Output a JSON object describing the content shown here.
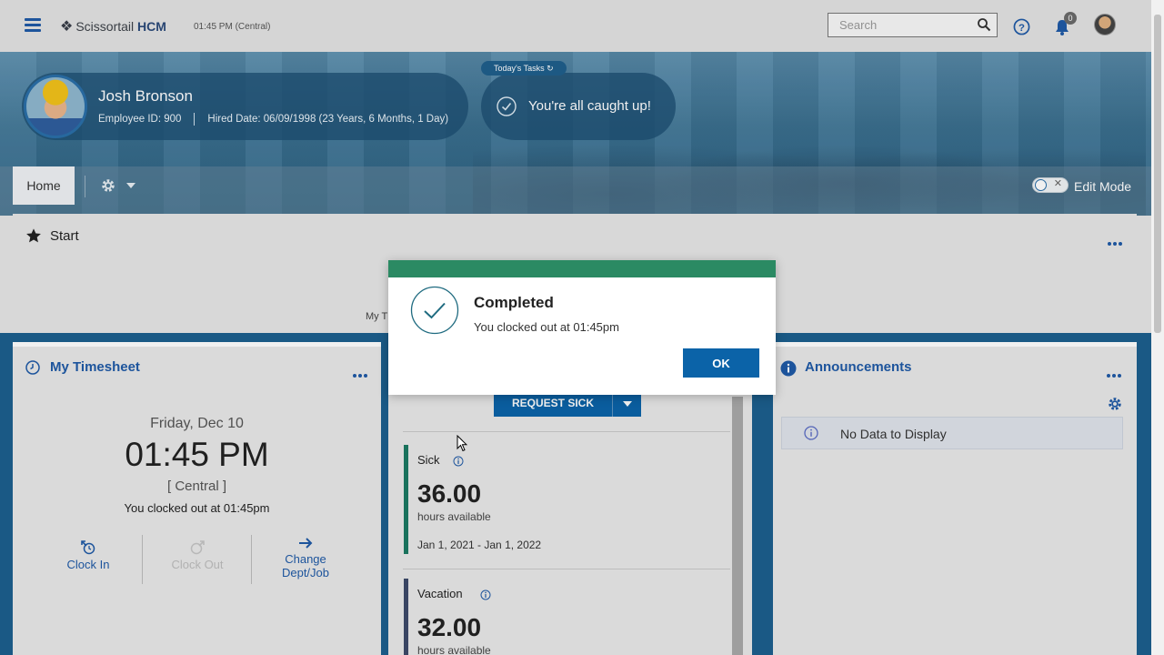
{
  "topbar": {
    "brand_prefix": "Scissortail",
    "brand_suffix": "HCM",
    "time": "01:45 PM (Central)",
    "search_placeholder": "Search",
    "notification_count": "0"
  },
  "profile": {
    "name": "Josh Bronson",
    "employee_id": "Employee ID: 900",
    "hired": "Hired Date: 06/09/1998 (23 Years, 6 Months, 1 Day)"
  },
  "tasks": {
    "label": "Today's Tasks",
    "status": "You're all caught up!"
  },
  "nav": {
    "home_tab": "Home",
    "edit_mode": "Edit Mode"
  },
  "start": {
    "title": "Start",
    "partial_label": "My T"
  },
  "timesheet": {
    "title": "My Timesheet",
    "date": "Friday, Dec 10",
    "time": "01:45 PM",
    "zone": "[ Central ]",
    "status": "You clocked out at 01:45pm",
    "clock_in": "Clock In",
    "clock_out": "Clock Out",
    "change_line1": "Change",
    "change_line2": "Dept/Job"
  },
  "time_off": {
    "request_button": "REQUEST SICK",
    "balances": [
      {
        "name": "Sick",
        "hours": "36.00",
        "unit": "hours available",
        "range": "Jan 1, 2021 - Jan 1, 2022"
      },
      {
        "name": "Vacation",
        "hours": "32.00",
        "unit": "hours available"
      }
    ]
  },
  "announcements": {
    "title": "Announcements",
    "empty": "No Data to Display"
  },
  "modal": {
    "title": "Completed",
    "message": "You clocked out at 01:45pm",
    "ok": "OK"
  },
  "colors": {
    "brand_blue": "#1f5aa6",
    "button_blue": "#0b63a8",
    "success_green": "#2b8a63",
    "strip_blue": "#1c5f8e"
  }
}
